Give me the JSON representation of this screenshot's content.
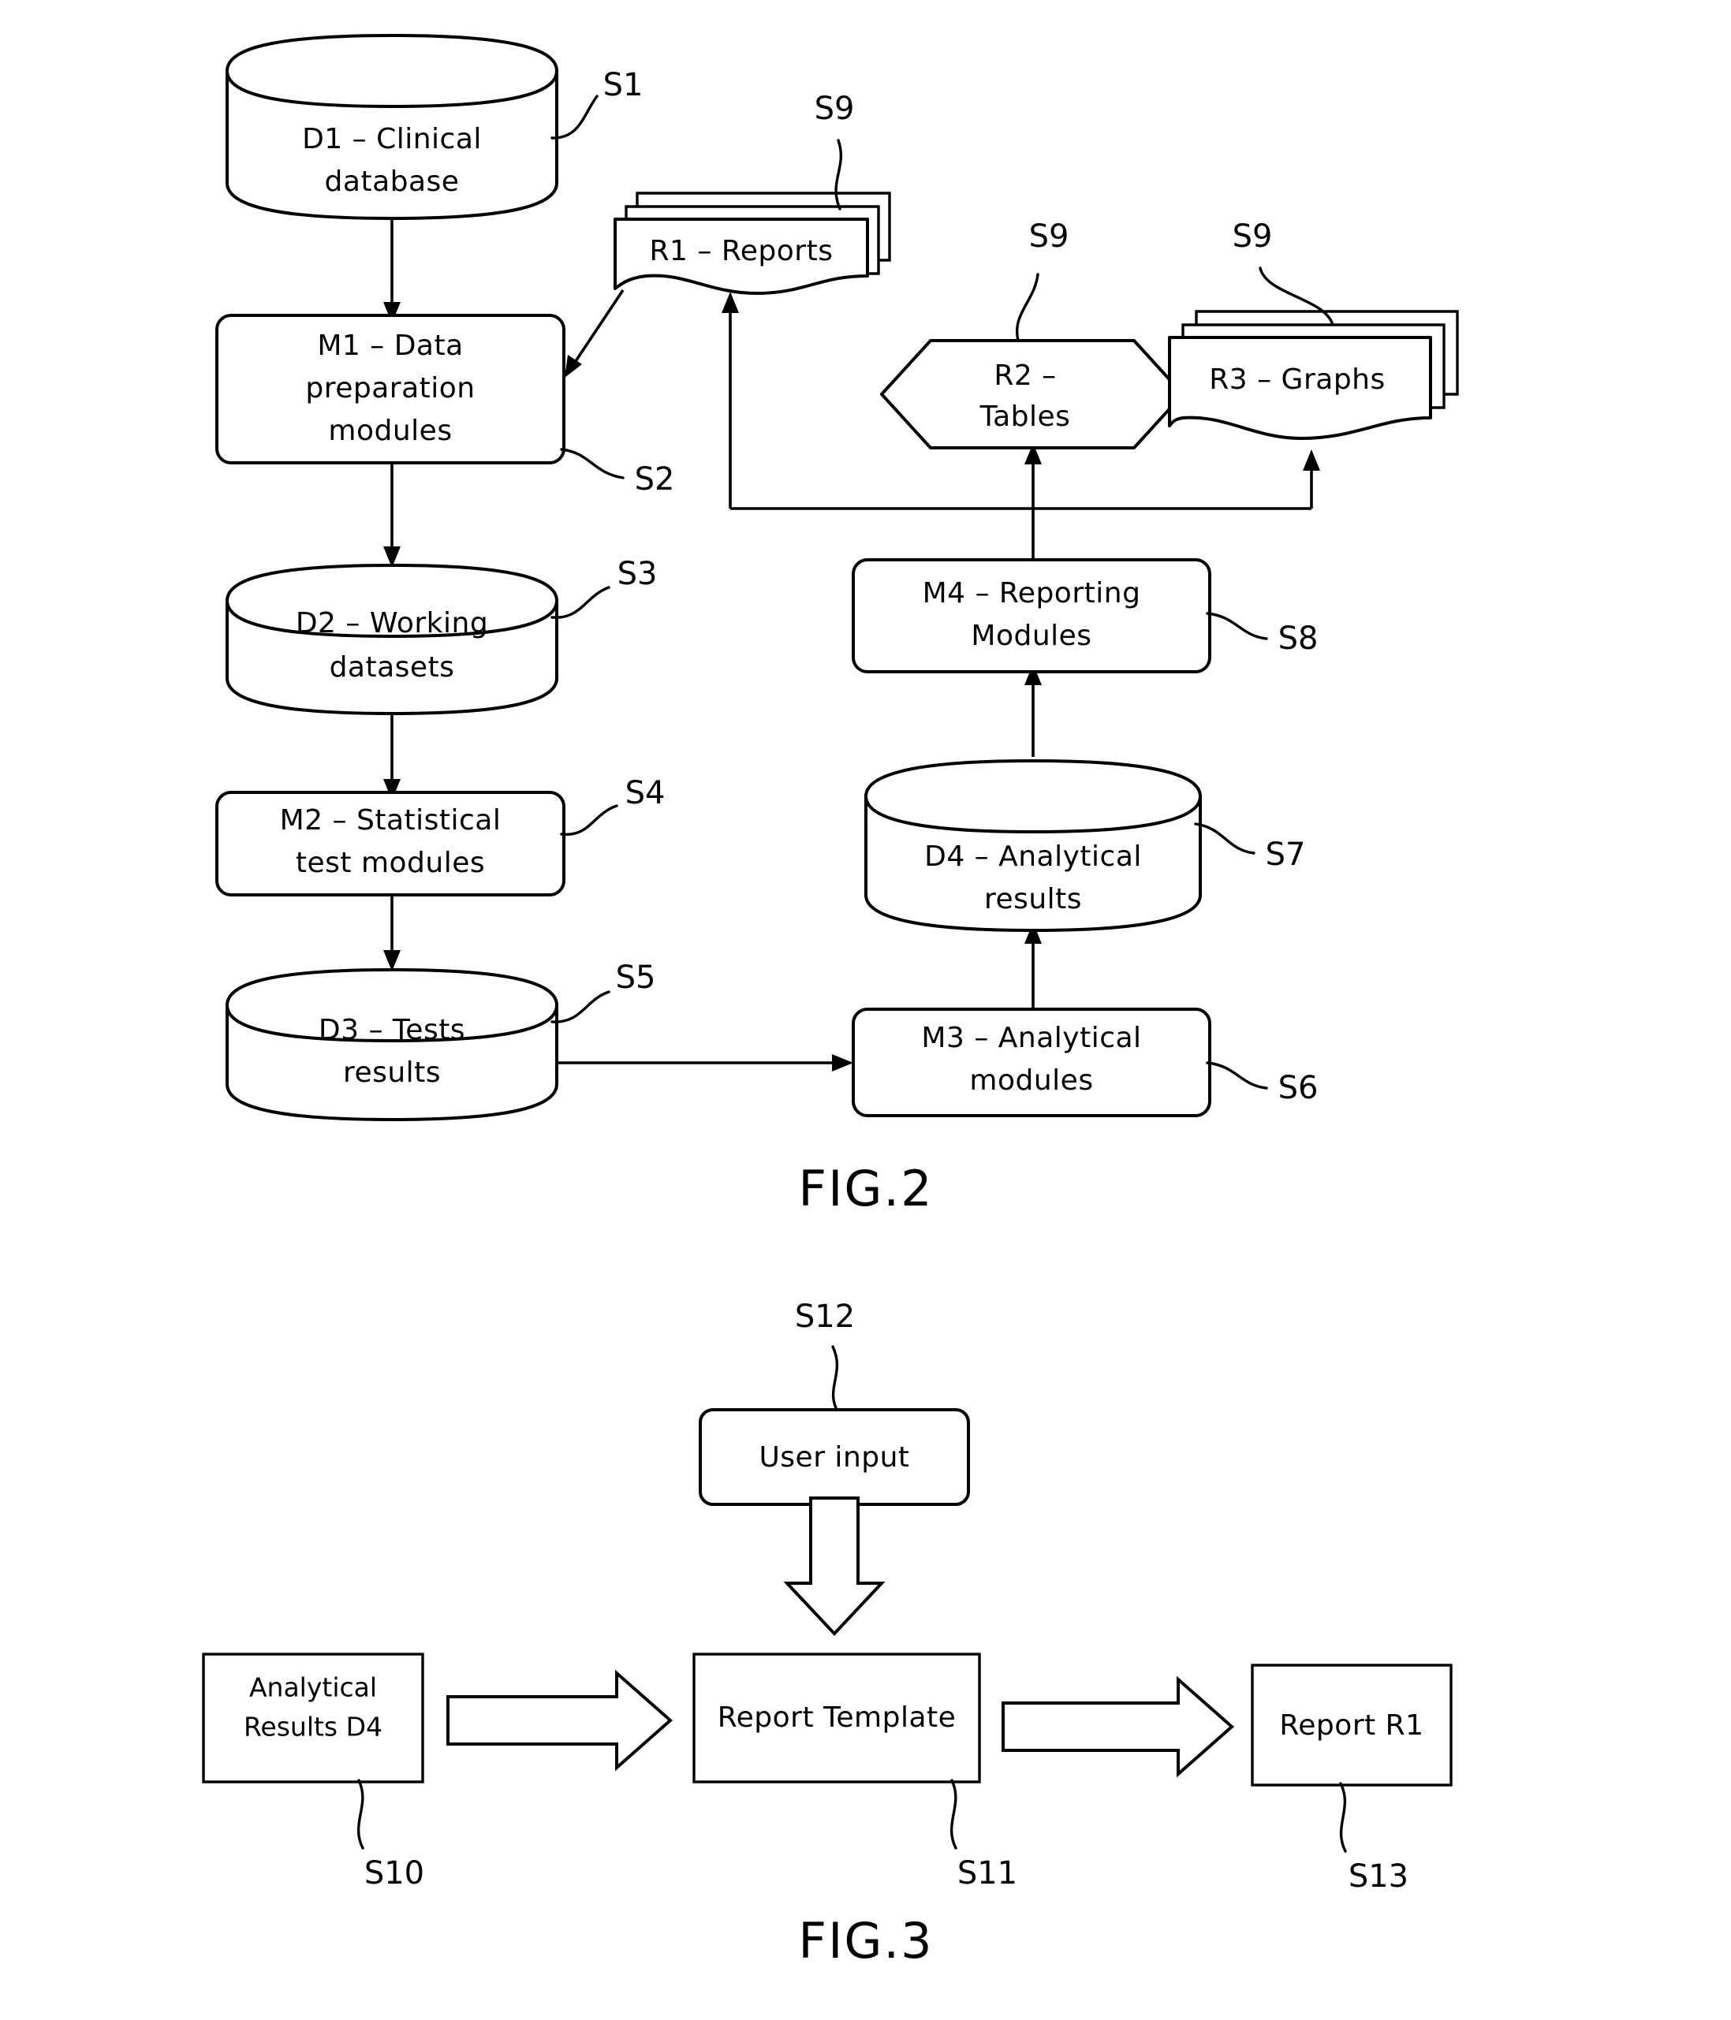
{
  "figures": [
    {
      "caption": "FIG.2",
      "nodes": {
        "d1": {
          "line1": "D1  –  Clinical",
          "line2": "database",
          "ref": "S1",
          "shape": "cylinder"
        },
        "m1": {
          "line1": "M1  –  Data",
          "line2": "preparation",
          "line3": "modules",
          "ref": "S2",
          "shape": "rounded-rect"
        },
        "d2": {
          "line1": "D2  –  Working",
          "line2": "datasets",
          "ref": "S3",
          "shape": "cylinder"
        },
        "m2": {
          "line1": "M2  –  Statistical",
          "line2": "test  modules",
          "ref": "S4",
          "shape": "rounded-rect"
        },
        "d3": {
          "line1": "D3  –  Tests",
          "line2": "results",
          "ref": "S5",
          "shape": "cylinder"
        },
        "m3": {
          "line1": "M3  –  Analytical",
          "line2": "modules",
          "ref": "S6",
          "shape": "rounded-rect"
        },
        "d4": {
          "line1": "D4  –  Analytical",
          "line2": "results",
          "ref": "S7",
          "shape": "cylinder"
        },
        "m4": {
          "line1": "M4  –  Reporting",
          "line2": "Modules",
          "ref": "S8",
          "shape": "rounded-rect"
        },
        "r1": {
          "line1": "R1  –  Reports",
          "ref": "S9",
          "shape": "document-stack"
        },
        "r2": {
          "line1": "R2  –",
          "line2": "Tables",
          "ref": "S9",
          "shape": "hexagon"
        },
        "r3": {
          "line1": "R3  –  Graphs",
          "ref": "S9",
          "shape": "document-stack"
        }
      }
    },
    {
      "caption": "FIG.3",
      "nodes": {
        "user_input": {
          "line1": "User  input",
          "ref": "S12",
          "shape": "rounded-rect"
        },
        "analytical_results": {
          "line1": "Analytical",
          "line2": "Results  D4",
          "ref": "S10",
          "shape": "rect"
        },
        "report_template": {
          "line1": "Report  Template",
          "ref": "S11",
          "shape": "rect"
        },
        "report_r1": {
          "line1": "Report  R1",
          "ref": "S13",
          "shape": "rect"
        }
      }
    }
  ],
  "colors": {
    "ink": "#000000",
    "paper": "#ffffff"
  }
}
